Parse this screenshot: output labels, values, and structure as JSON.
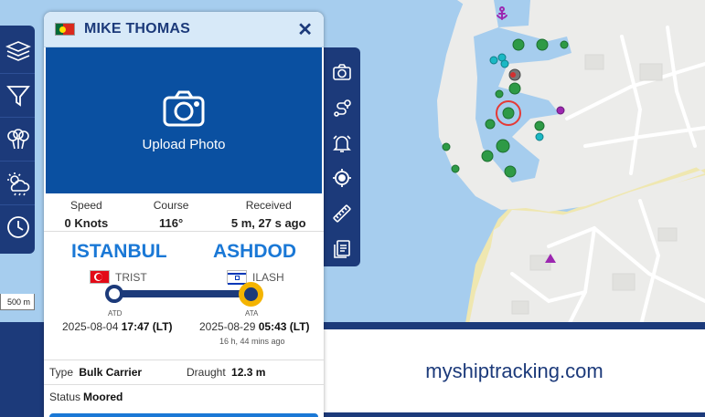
{
  "vessel": {
    "name": "MIKE THOMAS",
    "flag_icon": "portugal-flag-icon",
    "upload_label": "Upload Photo"
  },
  "stats": {
    "speed": {
      "label": "Speed",
      "value": "0 Knots"
    },
    "course": {
      "label": "Course",
      "value": "116°"
    },
    "received": {
      "label": "Received",
      "value": "5 m, 27 s ago"
    }
  },
  "route": {
    "departure": {
      "port": "ISTANBUL",
      "code": "TRIST",
      "flag_icon": "turkey-flag-icon",
      "tag": "ATD",
      "date": "2025-08-04",
      "time": "17:47 (LT)"
    },
    "arrival": {
      "port": "ASHDOD",
      "code": "ILASH",
      "flag_icon": "israel-flag-icon",
      "tag": "ATA",
      "date": "2025-08-29",
      "time": "05:43 (LT)",
      "elapsed": "16 h, 44 mins ago"
    },
    "progress": 1.0
  },
  "details": {
    "type_label": "Type",
    "type_value": "Bulk Carrier",
    "draught_label": "Draught",
    "draught_value": "12.3 m",
    "status_label": "Status",
    "status_value": "Moored"
  },
  "map": {
    "scale_label": "500 m",
    "anchor_icon": "anchor-icon",
    "colors": {
      "water": "#a6cdee",
      "land": "#ececea",
      "sand": "#efe7b0",
      "green_vessel": "#2e9a46",
      "cyan_vessel": "#1bb8c4",
      "purple_vessel": "#9c27b0",
      "selection_ring": "#e53935"
    }
  },
  "toolbars": {
    "left": [
      "layers-icon",
      "filter-icon",
      "balloons-icon",
      "weather-icon",
      "history-icon"
    ],
    "right": [
      "camera-icon",
      "route-icon",
      "alarm-icon",
      "locate-icon",
      "ruler-icon",
      "report-icon"
    ]
  },
  "banner": {
    "text": "myshiptracking.com"
  }
}
